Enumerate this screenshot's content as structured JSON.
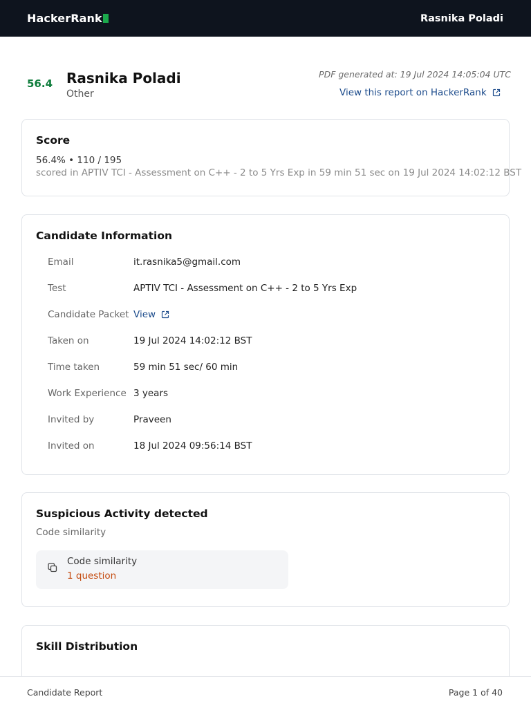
{
  "topbar": {
    "brand": "HackerRank",
    "user_name": "Rasnika Poladi"
  },
  "header": {
    "score": "56.4",
    "candidate_name": "Rasnika Poladi",
    "role": "Other",
    "pdf_generated": "PDF generated at: 19 Jul 2024 14:05:04 UTC",
    "view_report_label": "View this report on HackerRank"
  },
  "score_card": {
    "title": "Score",
    "summary": "56.4% • 110 / 195",
    "description": "scored in APTIV TCI - Assessment on C++ - 2 to 5 Yrs Exp in 59 min 51 sec on 19 Jul 2024 14:02:12 BST"
  },
  "candidate_info": {
    "title": "Candidate Information",
    "rows": [
      {
        "label": "Email",
        "value": "it.rasnika5@gmail.com"
      },
      {
        "label": "Test",
        "value": "APTIV TCI - Assessment on C++ - 2 to 5 Yrs Exp"
      },
      {
        "label": "Candidate Packet",
        "value": "View"
      },
      {
        "label": "Taken on",
        "value": "19 Jul 2024 14:02:12 BST"
      },
      {
        "label": "Time taken",
        "value": "59 min 51 sec/ 60 min"
      },
      {
        "label": "Work Experience",
        "value": "3 years"
      },
      {
        "label": "Invited by",
        "value": "Praveen"
      },
      {
        "label": "Invited on",
        "value": "18 Jul 2024 09:56:14 BST"
      }
    ]
  },
  "suspicious": {
    "title": "Suspicious Activity detected",
    "subtitle": "Code similarity",
    "item_title": "Code similarity",
    "item_count": "1 question"
  },
  "skill_distribution": {
    "title": "Skill Distribution"
  },
  "footer": {
    "left": "Candidate Report",
    "right": "Page 1 of 40"
  },
  "colors": {
    "topbar_bg": "#0e141e",
    "brand_accent": "#1ba94c",
    "score_green": "#0f7d3c",
    "link_blue": "#1d4c8c",
    "warning_orange": "#c44a0e"
  }
}
